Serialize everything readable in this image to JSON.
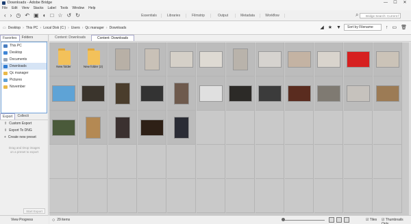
{
  "window": {
    "title": "Downloads - Adobe Bridge",
    "min": "—",
    "max": "☐",
    "close": "✕"
  },
  "menu": [
    "File",
    "Edit",
    "View",
    "Stacks",
    "Label",
    "Tools",
    "Window",
    "Help"
  ],
  "workspaces": [
    "Essentials",
    "Libraries",
    "Filmstrip",
    "Output",
    "Metadata",
    "Workflow"
  ],
  "search": {
    "placeholder": "Bridge Search: Current f"
  },
  "breadcrumb": [
    "Desktop",
    "This PC",
    "Local Disk (C:)",
    "Users",
    "Qc manager",
    "Downloads"
  ],
  "sort": {
    "label": "Sort by Filename"
  },
  "left_tabs": {
    "favorites": "Favorites",
    "folders": "Folders"
  },
  "favorites": [
    "This PC",
    "Desktop",
    "Documents",
    "Downloads",
    "Qc manager",
    "Pictures",
    "November"
  ],
  "export": {
    "tab_export": "Export",
    "tab_collections": "Collecti",
    "items": [
      "Custom Export",
      "Export To DNG",
      "Create new preset"
    ],
    "hint": "Drag and Drop images on a preset to export",
    "start": "Start Export",
    "view_progress": "View Progress"
  },
  "content_tabs": [
    "Content: Downloads",
    "Content: Downloads"
  ],
  "folder_names": [
    "New folder",
    "New folder (2)"
  ],
  "status": {
    "count": "29 items",
    "tiles": "Tiles",
    "thumbs_only": "Thumbnails Only"
  },
  "colors": {
    "accent": "#6ea0d8",
    "folder": "#f3c15a",
    "grid_bg": "#c9c9c9"
  }
}
